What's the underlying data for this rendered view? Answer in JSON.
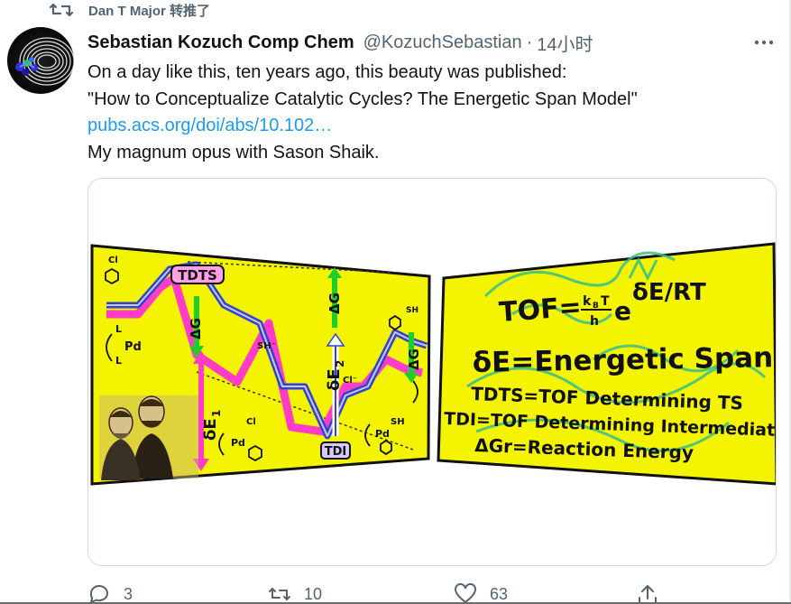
{
  "retweet": {
    "text": "Dan T Major 转推了"
  },
  "tweet": {
    "author_name": "Sebastian Kozuch Comp Chem",
    "handle": "@KozuchSebastian",
    "separator": "·",
    "time": "14小时",
    "lines": [
      "On a day like this, ten years ago, this beauty was published:",
      "\"How to Conceptualize Catalytic Cycles? The Energetic Span Model\"",
      "pubs.acs.org/doi/abs/10.102…",
      "My magnum opus with Sason Shaik."
    ]
  },
  "figure": {
    "left_labels": {
      "tdts": "TDTS",
      "tdi": "TDI",
      "dE1": "δE",
      "dE1_sub": "1",
      "dE2": "δE",
      "dE2_sub": "2",
      "dGr": "ΔG",
      "dGr_sub": "r",
      "pd": "Pd",
      "l": "L",
      "cl": "Cl",
      "sh": "SH",
      "sh_minus": "SH⁻",
      "cl_minus": "Cl⁻"
    },
    "right_text": {
      "tof": "TOF=",
      "kb": "k",
      "kb_sub": "B",
      "t": "T",
      "h": "h",
      "e": "e",
      "exponent": "δE/RT",
      "energetic_span": "δE=Energetic Span",
      "tdts_def": "TDTS=TOF Determining TS",
      "tdi_def": "TDI=TOF Determining Intermediate",
      "dgr_def": "ΔGr=Reaction Energy"
    },
    "colors": {
      "panel_yellow": "#f4f400",
      "pink": "#ff3cc8",
      "blue": "#3344cc",
      "green_arrow": "#1ccf2a",
      "dragon_green": "#35c08a",
      "tdts_box": "#ff9fe6"
    }
  },
  "actions": {
    "reply_count": "3",
    "retweet_count": "10",
    "like_count": "63"
  },
  "colors": {
    "text_primary": "#0f1419",
    "text_secondary": "#536471",
    "link": "#1d9bf0",
    "border": "#cfd9de"
  }
}
